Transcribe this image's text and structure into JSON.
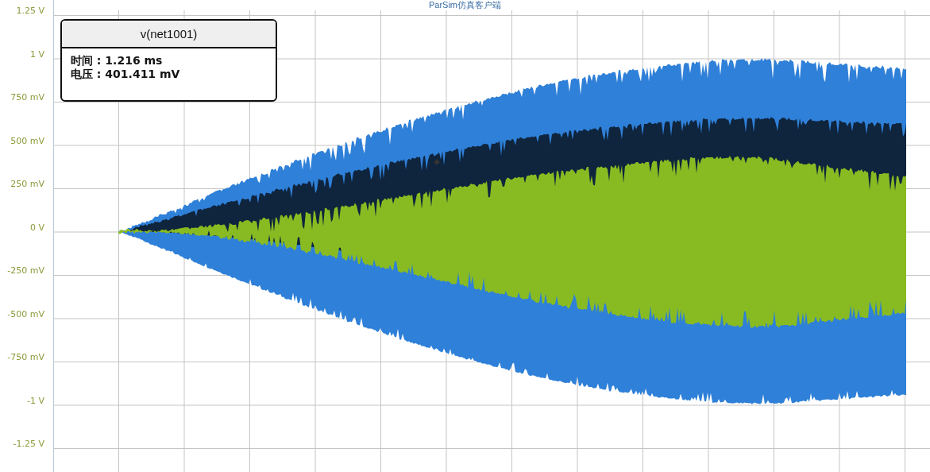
{
  "window": {
    "title": "ParSim仿真客户端"
  },
  "y_axis": {
    "ticks": [
      "1.25 V",
      "1 V",
      "750 mV",
      "500 mV",
      "250 mV",
      "0 V",
      "-250 mV",
      "-500 mV",
      "-750 mV",
      "-1 V",
      "-1.25 V"
    ]
  },
  "tooltip": {
    "title": "v(net1001)",
    "lines": [
      "时间 : 1.216 ms",
      "电压 : 401.411 mV"
    ]
  }
}
